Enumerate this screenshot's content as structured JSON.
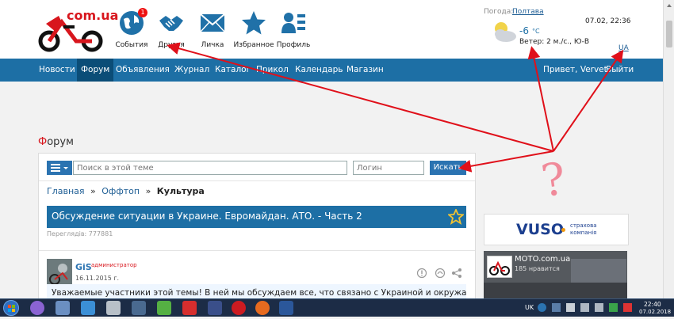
{
  "header": {
    "logo_text": "com.ua",
    "weather_label": "Погода:",
    "weather_city": "Полтава",
    "datetime": "07.02, 22:36",
    "temperature": "-6",
    "temp_unit": "°C",
    "wind": "Ветер: 2 м./с., Ю-В",
    "lang": "UA",
    "icons": [
      {
        "label": "События",
        "icon": "globe-icon",
        "badge": "1"
      },
      {
        "label": "Друзья",
        "icon": "handshake-icon"
      },
      {
        "label": "Личка",
        "icon": "mail-icon"
      },
      {
        "label": "Избранное",
        "icon": "star-icon"
      },
      {
        "label": "Профиль",
        "icon": "profile-icon"
      }
    ]
  },
  "nav": {
    "items": [
      "Новости",
      "Форум",
      "Объявления",
      "Журнал",
      "Каталог",
      "Прикол",
      "Календарь",
      "Магазин"
    ],
    "active": "Форум",
    "greeting": "Привет, Vervet",
    "logout": "Выйти"
  },
  "forum": {
    "heading_first": "Ф",
    "heading_rest": "орум",
    "search_placeholder": "Поиск в этой теме",
    "login_placeholder": "Логин",
    "search_button": "Искать",
    "breadcrumb": [
      "Главная",
      "Оффтоп",
      "Культура"
    ],
    "breadcrumb_sep": "»",
    "topic_title": "Обсуждение ситуации в Украине. Евромайдан. АТО. - Часть 2",
    "views": "Переглядів: 777881",
    "post": {
      "author": "GiS",
      "role": "администратор",
      "date": "16.11.2015 г.",
      "text": "Уважаемые участники этой темы! В ней мы обсуждаем все, что связано с Украиной и окружающими"
    }
  },
  "sidebar": {
    "ad1_brand": "VUSO",
    "ad1_sub1": "страхова",
    "ad1_sub2": "компанія",
    "ad2_title": "MOTO.com.ua",
    "ad2_likes": "185 нравится"
  },
  "annotation": {
    "question_mark": "?",
    "arrow_color": "#e0101a"
  },
  "taskbar": {
    "lang": "UK",
    "time": "22:40",
    "date": "07.02.2018"
  }
}
